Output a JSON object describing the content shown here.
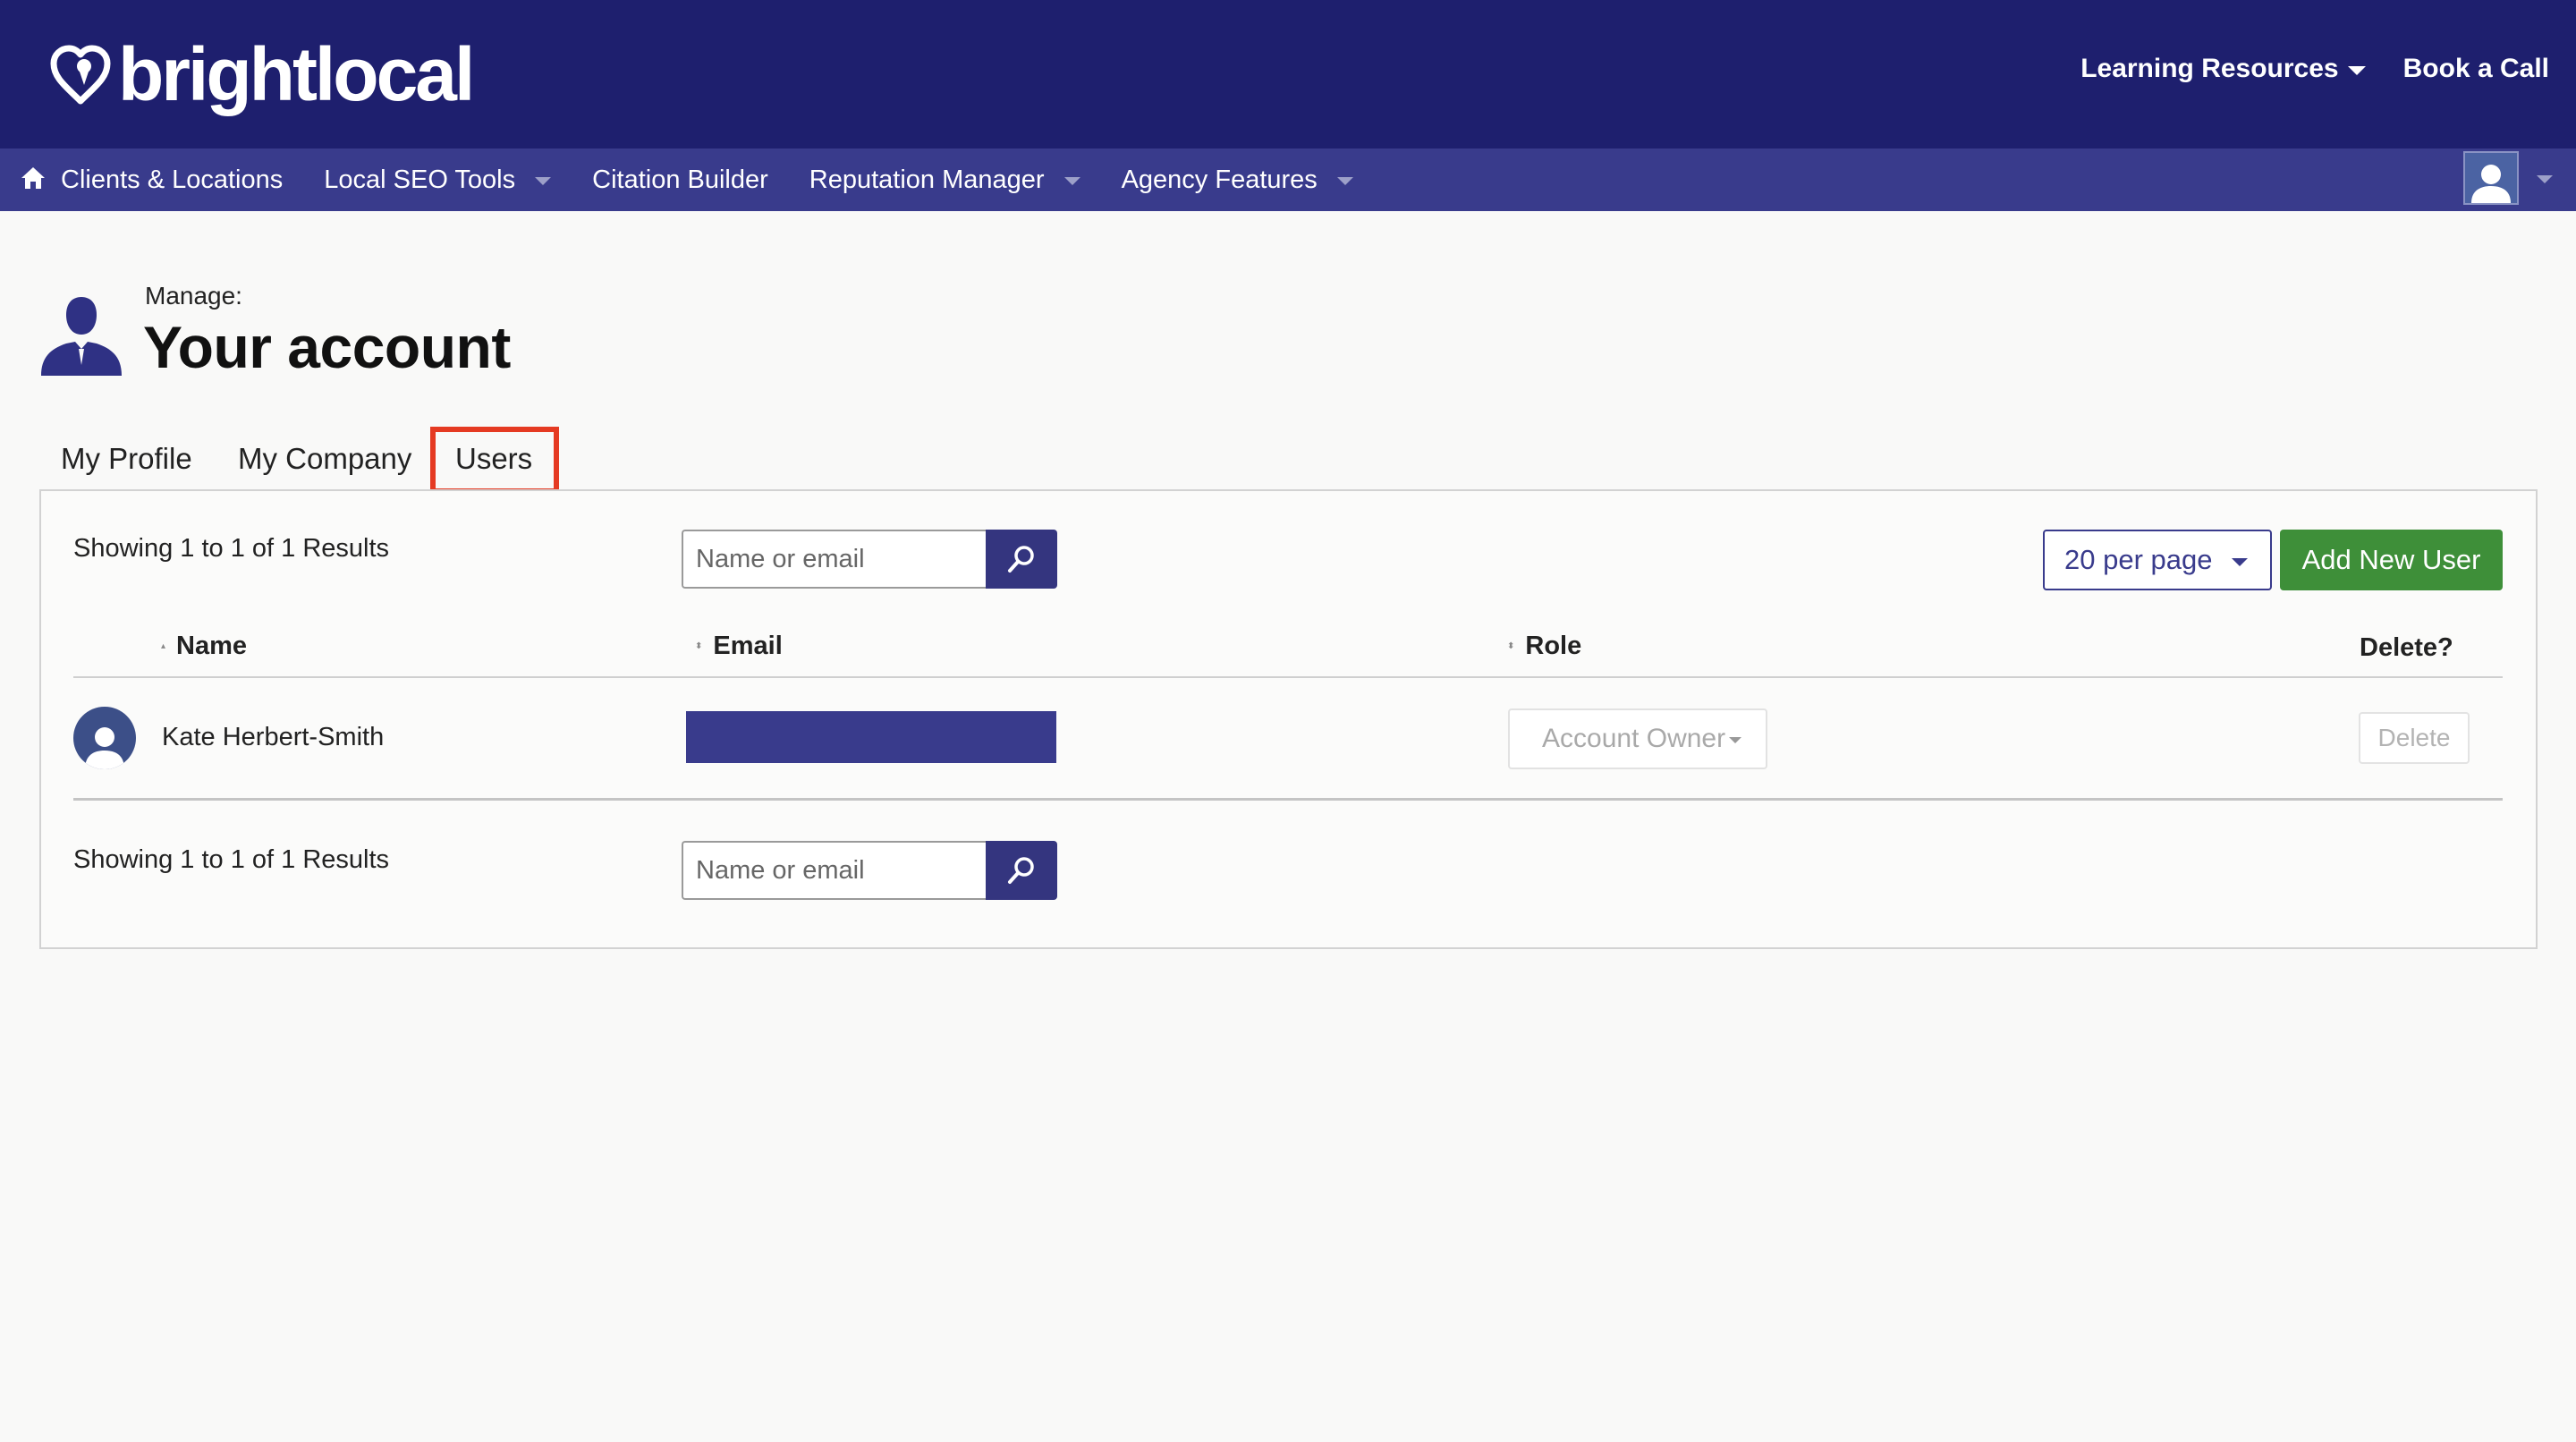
{
  "brand": {
    "name": "brightlocal",
    "color": "#1e1f6e"
  },
  "top_links": [
    {
      "label": "Learning Resources",
      "has_dropdown": true
    },
    {
      "label": "Book a Call",
      "has_dropdown": false
    }
  ],
  "nav": {
    "items": [
      {
        "label": "Clients & Locations",
        "has_dropdown": false
      },
      {
        "label": "Local SEO Tools",
        "has_dropdown": true
      },
      {
        "label": "Citation Builder",
        "has_dropdown": false
      },
      {
        "label": "Reputation Manager",
        "has_dropdown": true
      },
      {
        "label": "Agency Features",
        "has_dropdown": true
      }
    ],
    "icons": {
      "home": "home-icon",
      "account": "user-avatar-icon"
    }
  },
  "page": {
    "manage_label": "Manage:",
    "title": "Your account"
  },
  "tabs": [
    {
      "label": "My Profile",
      "active": false
    },
    {
      "label": "My Company",
      "active": false
    },
    {
      "label": "Users",
      "active": true,
      "highlight_color": "#e53a22"
    }
  ],
  "users_panel": {
    "showing_top": "Showing 1 to 1 of 1 Results",
    "showing_bottom": "Showing 1 to 1 of 1 Results",
    "search_placeholder": "Name or email",
    "per_page_label": "20 per page",
    "add_user_label": "Add New User",
    "columns": {
      "name": "Name",
      "email": "Email",
      "role": "Role",
      "delete": "Delete?"
    },
    "rows": [
      {
        "name": "Kate Herbert-Smith",
        "email_redacted": true,
        "role": "Account Owner",
        "delete_label": "Delete"
      }
    ]
  },
  "colors": {
    "nav_bar": "#393b8c",
    "search_button": "#34357f",
    "add_button": "#3e8f39",
    "page_background": "#f9f9f8"
  }
}
